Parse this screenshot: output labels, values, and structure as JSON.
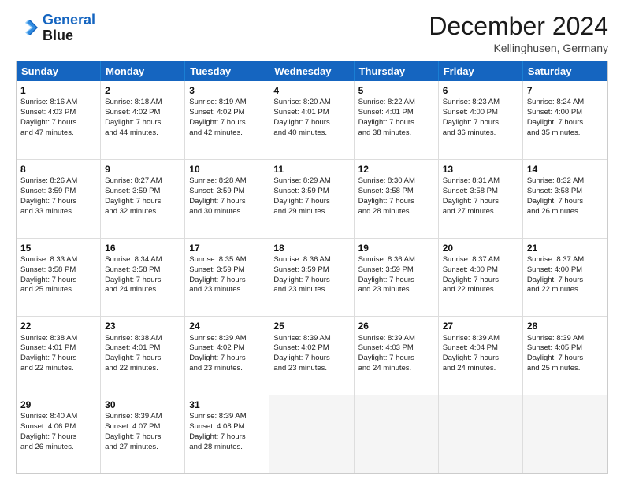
{
  "logo": {
    "line1": "General",
    "line2": "Blue"
  },
  "title": "December 2024",
  "subtitle": "Kellinghusen, Germany",
  "days": [
    "Sunday",
    "Monday",
    "Tuesday",
    "Wednesday",
    "Thursday",
    "Friday",
    "Saturday"
  ],
  "rows": [
    [
      {
        "day": "1",
        "sunrise": "8:16 AM",
        "sunset": "4:03 PM",
        "daylight": "7 hours and 47 minutes."
      },
      {
        "day": "2",
        "sunrise": "8:18 AM",
        "sunset": "4:02 PM",
        "daylight": "7 hours and 44 minutes."
      },
      {
        "day": "3",
        "sunrise": "8:19 AM",
        "sunset": "4:02 PM",
        "daylight": "7 hours and 42 minutes."
      },
      {
        "day": "4",
        "sunrise": "8:20 AM",
        "sunset": "4:01 PM",
        "daylight": "7 hours and 40 minutes."
      },
      {
        "day": "5",
        "sunrise": "8:22 AM",
        "sunset": "4:01 PM",
        "daylight": "7 hours and 38 minutes."
      },
      {
        "day": "6",
        "sunrise": "8:23 AM",
        "sunset": "4:00 PM",
        "daylight": "7 hours and 36 minutes."
      },
      {
        "day": "7",
        "sunrise": "8:24 AM",
        "sunset": "4:00 PM",
        "daylight": "7 hours and 35 minutes."
      }
    ],
    [
      {
        "day": "8",
        "sunrise": "8:26 AM",
        "sunset": "3:59 PM",
        "daylight": "7 hours and 33 minutes."
      },
      {
        "day": "9",
        "sunrise": "8:27 AM",
        "sunset": "3:59 PM",
        "daylight": "7 hours and 32 minutes."
      },
      {
        "day": "10",
        "sunrise": "8:28 AM",
        "sunset": "3:59 PM",
        "daylight": "7 hours and 30 minutes."
      },
      {
        "day": "11",
        "sunrise": "8:29 AM",
        "sunset": "3:59 PM",
        "daylight": "7 hours and 29 minutes."
      },
      {
        "day": "12",
        "sunrise": "8:30 AM",
        "sunset": "3:58 PM",
        "daylight": "7 hours and 28 minutes."
      },
      {
        "day": "13",
        "sunrise": "8:31 AM",
        "sunset": "3:58 PM",
        "daylight": "7 hours and 27 minutes."
      },
      {
        "day": "14",
        "sunrise": "8:32 AM",
        "sunset": "3:58 PM",
        "daylight": "7 hours and 26 minutes."
      }
    ],
    [
      {
        "day": "15",
        "sunrise": "8:33 AM",
        "sunset": "3:58 PM",
        "daylight": "7 hours and 25 minutes."
      },
      {
        "day": "16",
        "sunrise": "8:34 AM",
        "sunset": "3:58 PM",
        "daylight": "7 hours and 24 minutes."
      },
      {
        "day": "17",
        "sunrise": "8:35 AM",
        "sunset": "3:59 PM",
        "daylight": "7 hours and 23 minutes."
      },
      {
        "day": "18",
        "sunrise": "8:36 AM",
        "sunset": "3:59 PM",
        "daylight": "7 hours and 23 minutes."
      },
      {
        "day": "19",
        "sunrise": "8:36 AM",
        "sunset": "3:59 PM",
        "daylight": "7 hours and 23 minutes."
      },
      {
        "day": "20",
        "sunrise": "8:37 AM",
        "sunset": "4:00 PM",
        "daylight": "7 hours and 22 minutes."
      },
      {
        "day": "21",
        "sunrise": "8:37 AM",
        "sunset": "4:00 PM",
        "daylight": "7 hours and 22 minutes."
      }
    ],
    [
      {
        "day": "22",
        "sunrise": "8:38 AM",
        "sunset": "4:01 PM",
        "daylight": "7 hours and 22 minutes."
      },
      {
        "day": "23",
        "sunrise": "8:38 AM",
        "sunset": "4:01 PM",
        "daylight": "7 hours and 22 minutes."
      },
      {
        "day": "24",
        "sunrise": "8:39 AM",
        "sunset": "4:02 PM",
        "daylight": "7 hours and 23 minutes."
      },
      {
        "day": "25",
        "sunrise": "8:39 AM",
        "sunset": "4:02 PM",
        "daylight": "7 hours and 23 minutes."
      },
      {
        "day": "26",
        "sunrise": "8:39 AM",
        "sunset": "4:03 PM",
        "daylight": "7 hours and 24 minutes."
      },
      {
        "day": "27",
        "sunrise": "8:39 AM",
        "sunset": "4:04 PM",
        "daylight": "7 hours and 24 minutes."
      },
      {
        "day": "28",
        "sunrise": "8:39 AM",
        "sunset": "4:05 PM",
        "daylight": "7 hours and 25 minutes."
      }
    ],
    [
      {
        "day": "29",
        "sunrise": "8:40 AM",
        "sunset": "4:06 PM",
        "daylight": "7 hours and 26 minutes."
      },
      {
        "day": "30",
        "sunrise": "8:39 AM",
        "sunset": "4:07 PM",
        "daylight": "7 hours and 27 minutes."
      },
      {
        "day": "31",
        "sunrise": "8:39 AM",
        "sunset": "4:08 PM",
        "daylight": "7 hours and 28 minutes."
      },
      null,
      null,
      null,
      null
    ]
  ]
}
